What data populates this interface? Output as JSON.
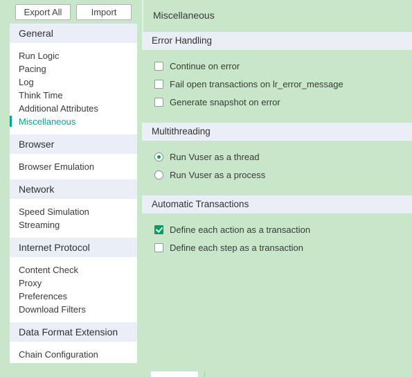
{
  "toolbar": {
    "export_all_label": "Export All",
    "import_label": "Import"
  },
  "sidebar": {
    "groups": [
      {
        "header": "General",
        "items": [
          {
            "label": "Run Logic",
            "active": false
          },
          {
            "label": "Pacing",
            "active": false
          },
          {
            "label": "Log",
            "active": false
          },
          {
            "label": "Think Time",
            "active": false
          },
          {
            "label": "Additional Attributes",
            "active": false
          },
          {
            "label": "Miscellaneous",
            "active": true
          }
        ]
      },
      {
        "header": "Browser",
        "items": [
          {
            "label": "Browser Emulation",
            "active": false
          }
        ]
      },
      {
        "header": "Network",
        "items": [
          {
            "label": "Speed Simulation",
            "active": false
          },
          {
            "label": "Streaming",
            "active": false
          }
        ]
      },
      {
        "header": "Internet Protocol",
        "items": [
          {
            "label": "Content Check",
            "active": false
          },
          {
            "label": "Proxy",
            "active": false
          },
          {
            "label": "Preferences",
            "active": false
          },
          {
            "label": "Download Filters",
            "active": false
          }
        ]
      },
      {
        "header": "Data Format Extension",
        "items": [
          {
            "label": "Chain Configuration",
            "active": false
          }
        ]
      }
    ]
  },
  "main": {
    "title": "Miscellaneous",
    "sections": [
      {
        "header": "Error Handling",
        "options": [
          {
            "type": "checkbox",
            "label": "Continue on error",
            "checked": false
          },
          {
            "type": "checkbox",
            "label": "Fail open transactions on lr_error_message",
            "checked": false
          },
          {
            "type": "checkbox",
            "label": "Generate snapshot on error",
            "checked": false
          }
        ]
      },
      {
        "header": "Multithreading",
        "options": [
          {
            "type": "radio",
            "label": "Run Vuser as a thread",
            "checked": true
          },
          {
            "type": "radio",
            "label": "Run Vuser as a process",
            "checked": false
          }
        ]
      },
      {
        "header": "Automatic Transactions",
        "options": [
          {
            "type": "checkbox",
            "label": "Define each action as a transaction",
            "checked": true
          },
          {
            "type": "checkbox",
            "label": "Define each step as a transaction",
            "checked": false
          }
        ]
      }
    ]
  },
  "colors": {
    "background_green": "#c8e6c9",
    "section_header": "#e9eef7",
    "accent_teal": "#00a98f",
    "accent_check": "#00a060"
  }
}
